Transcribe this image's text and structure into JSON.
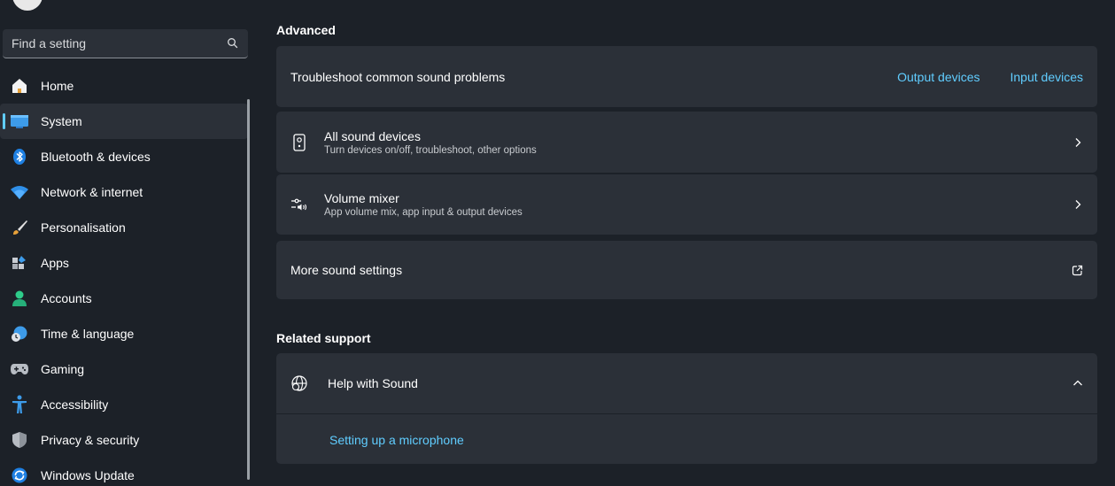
{
  "search": {
    "placeholder": "Find a setting"
  },
  "sidebar": {
    "items": [
      {
        "label": "Home",
        "icon": "home-icon"
      },
      {
        "label": "System",
        "icon": "system-icon",
        "selected": true
      },
      {
        "label": "Bluetooth & devices",
        "icon": "bluetooth-icon"
      },
      {
        "label": "Network & internet",
        "icon": "wifi-icon"
      },
      {
        "label": "Personalisation",
        "icon": "brush-icon"
      },
      {
        "label": "Apps",
        "icon": "apps-icon"
      },
      {
        "label": "Accounts",
        "icon": "accounts-icon"
      },
      {
        "label": "Time & language",
        "icon": "time-language-icon"
      },
      {
        "label": "Gaming",
        "icon": "gamepad-icon"
      },
      {
        "label": "Accessibility",
        "icon": "accessibility-icon"
      },
      {
        "label": "Privacy & security",
        "icon": "shield-icon"
      },
      {
        "label": "Windows Update",
        "icon": "update-icon"
      }
    ]
  },
  "advanced": {
    "title": "Advanced",
    "troubleshoot": {
      "label": "Troubleshoot common sound problems",
      "output_link": "Output devices",
      "input_link": "Input devices"
    },
    "all_devices": {
      "title": "All sound devices",
      "subtitle": "Turn devices on/off, troubleshoot, other options"
    },
    "volume_mixer": {
      "title": "Volume mixer",
      "subtitle": "App volume mix, app input & output devices"
    },
    "more_settings": {
      "label": "More sound settings"
    }
  },
  "related_support": {
    "title": "Related support",
    "help": {
      "title": "Help with Sound",
      "link": "Setting up a microphone"
    }
  },
  "colors": {
    "background": "#1c2128",
    "card": "#2b3038",
    "accent": "#60cdff"
  }
}
